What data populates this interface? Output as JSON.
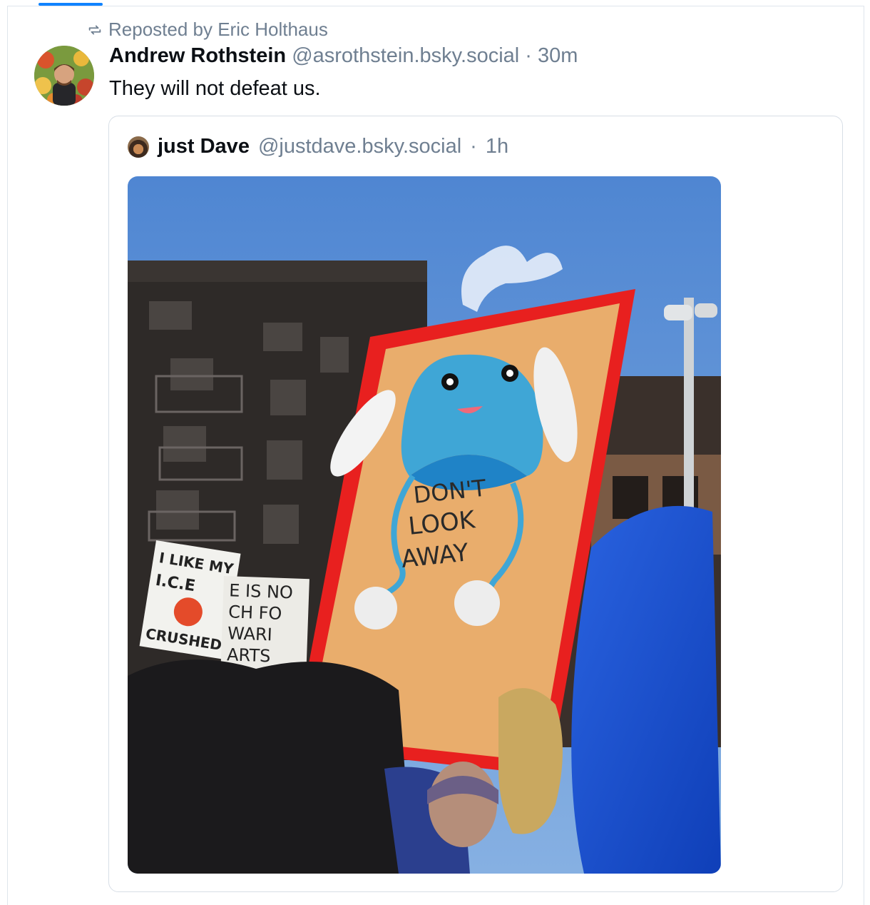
{
  "repost": {
    "icon": "repost-icon",
    "text": "Reposted by Eric Holthaus"
  },
  "post": {
    "author_name": "Andrew Rothstein",
    "author_handle": "@asrothstein.bsky.social",
    "separator": "·",
    "time": "30m",
    "text": "They will not defeat us."
  },
  "quote": {
    "author_name": "just Dave",
    "author_handle": "@justdave.bsky.social",
    "separator": "·",
    "time": "1h",
    "image": {
      "sign_text": [
        "DON'T",
        "LOOK",
        "AWAY"
      ],
      "background_sign_1": [
        "I LIKE MY",
        "I.C.E",
        "CRUSHED"
      ],
      "background_sign_2": [
        "E IS NO",
        "CH FO",
        "WARI",
        "ARTS"
      ]
    }
  },
  "colors": {
    "accent": "#1083fe",
    "muted_text": "#6f7f91",
    "sign_border": "#e8201f",
    "sign_paper": "#e9ad6c",
    "hat_blue": "#3fa6d6",
    "sky": "#5b8fd6"
  }
}
